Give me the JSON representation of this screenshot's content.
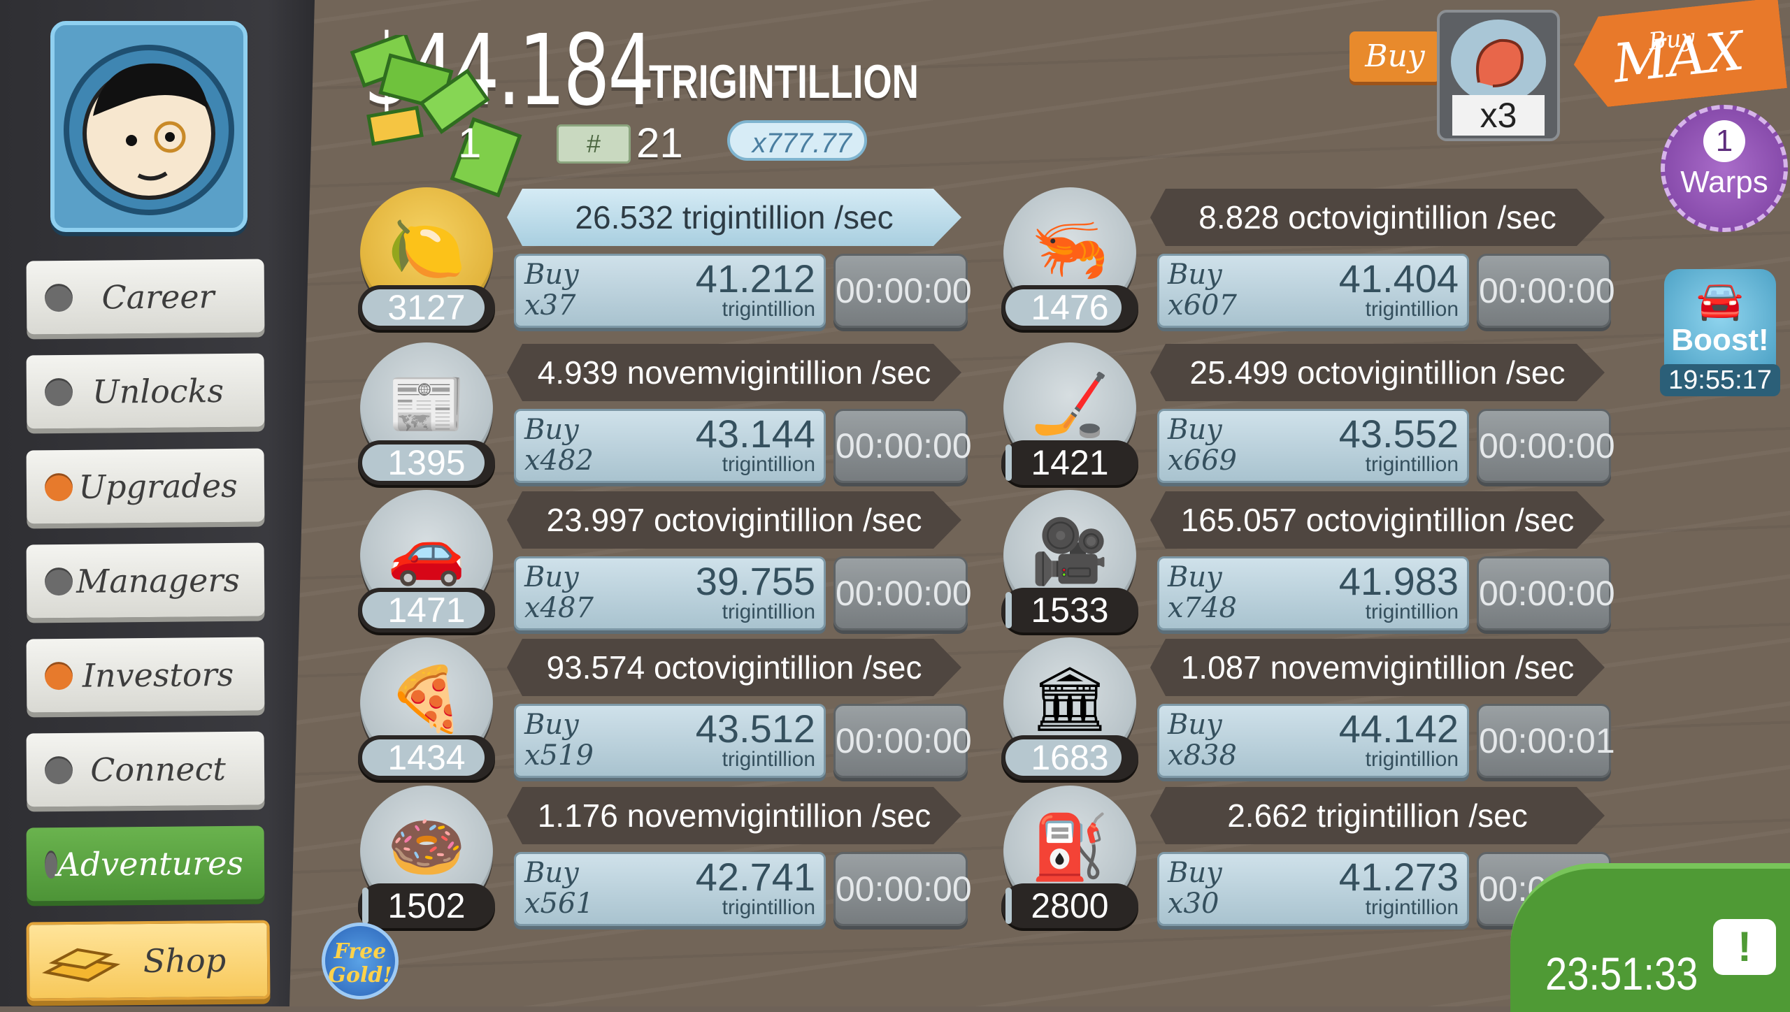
{
  "header": {
    "money_value": "$44.184",
    "money_unit": "TRIGINTILLION",
    "gold_count": "1",
    "ticket_count": "21",
    "multiplier": "x777.77"
  },
  "sidebar": {
    "items": [
      {
        "label": "Career",
        "dot": "gray"
      },
      {
        "label": "Unlocks",
        "dot": "gray"
      },
      {
        "label": "Upgrades",
        "dot": "orange"
      },
      {
        "label": "Managers",
        "dot": "gray"
      },
      {
        "label": "Investors",
        "dot": "orange"
      },
      {
        "label": "Connect",
        "dot": "gray"
      },
      {
        "label": "Adventures",
        "dot": "gray"
      },
      {
        "label": "Shop",
        "dot": "none"
      }
    ]
  },
  "topright": {
    "buy_label": "Buy",
    "mult_label": "x3",
    "buymax_small": "Buy",
    "buymax_big": "MAX",
    "warps_count": "1",
    "warps_label": "Warps",
    "boost_label": "Boost!",
    "boost_time": "19:55:17",
    "tv_time": "23:51:33",
    "tv_icon": "!"
  },
  "free_gold": "Free Gold!",
  "businesses": [
    {
      "icon": "lemon-icon",
      "glyph": "🍋",
      "count": "3127",
      "rate": "26.532 trigintillion /sec",
      "buy": "Buy",
      "qty": "x37",
      "cost": "41.212",
      "unit": "trigintillion",
      "timer": "00:00:00",
      "progress": 0.95,
      "highlight": true
    },
    {
      "icon": "shrimp-icon",
      "glyph": "🦐",
      "count": "1476",
      "rate": "8.828 octovigintillion /sec",
      "buy": "Buy",
      "qty": "x607",
      "cost": "41.404",
      "unit": "trigintillion",
      "timer": "00:00:00",
      "progress": 0.9,
      "highlight": false
    },
    {
      "icon": "newspaper-icon",
      "glyph": "📰",
      "count": "1395",
      "rate": "4.939 novemvigintillion /sec",
      "buy": "Buy",
      "qty": "x482",
      "cost": "43.144",
      "unit": "trigintillion",
      "timer": "00:00:00",
      "progress": 0.95,
      "highlight": false
    },
    {
      "icon": "hockey-icon",
      "glyph": "🏒",
      "count": "1421",
      "rate": "25.499 octovigintillion /sec",
      "buy": "Buy",
      "qty": "x669",
      "cost": "43.552",
      "unit": "trigintillion",
      "timer": "00:00:00",
      "progress": 0.05,
      "highlight": false
    },
    {
      "icon": "car-wash-icon",
      "glyph": "🚗",
      "count": "1471",
      "rate": "23.997 octovigintillion /sec",
      "buy": "Buy",
      "qty": "x487",
      "cost": "39.755",
      "unit": "trigintillion",
      "timer": "00:00:00",
      "progress": 0.95,
      "highlight": false
    },
    {
      "icon": "movie-camera-icon",
      "glyph": "🎥",
      "count": "1533",
      "rate": "165.057 octovigintillion /sec",
      "buy": "Buy",
      "qty": "x748",
      "cost": "41.983",
      "unit": "trigintillion",
      "timer": "00:00:00",
      "progress": 0.05,
      "highlight": false
    },
    {
      "icon": "pizza-icon",
      "glyph": "🍕",
      "count": "1434",
      "rate": "93.574 octovigintillion /sec",
      "buy": "Buy",
      "qty": "x519",
      "cost": "43.512",
      "unit": "trigintillion",
      "timer": "00:00:00",
      "progress": 0.95,
      "highlight": false
    },
    {
      "icon": "bank-icon",
      "glyph": "🏛",
      "count": "1683",
      "rate": "1.087 novemvigintillion /sec",
      "buy": "Buy",
      "qty": "x838",
      "cost": "44.142",
      "unit": "trigintillion",
      "timer": "00:00:01",
      "progress": 0.9,
      "highlight": false
    },
    {
      "icon": "donut-icon",
      "glyph": "🍩",
      "count": "1502",
      "rate": "1.176 novemvigintillion /sec",
      "buy": "Buy",
      "qty": "x561",
      "cost": "42.741",
      "unit": "trigintillion",
      "timer": "00:00:00",
      "progress": 0.05,
      "highlight": false
    },
    {
      "icon": "oil-rig-icon",
      "glyph": "⛽",
      "count": "2800",
      "rate": "2.662 trigintillion /sec",
      "buy": "Buy",
      "qty": "x30",
      "cost": "41.273",
      "unit": "trigintillion",
      "timer": "00:00:01",
      "progress": 0.05,
      "highlight": false
    }
  ]
}
